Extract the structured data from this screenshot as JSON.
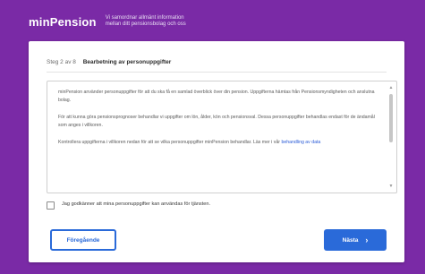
{
  "header": {
    "logo": "minPension",
    "tagline_line1": "Vi samordnar allmänt information",
    "tagline_line2": "mellan ditt pensionsbolag och oss"
  },
  "card": {
    "step": "Steg 2 av 8",
    "title": "Bearbetning av personuppgifter",
    "terms": {
      "p1": "minPension använder personuppgifter för att du ska få en samlad överblick över din pension. Uppgifterna hämtas från Pensionsmyndigheten och anslutna bolag.",
      "p2": "För att kunna göra pensionsprognoser behandlar vi uppgifter om lön, ålder, kön och pensionsval. Dessa personuppgifter behandlas endast för de ändamål som anges i villkoren.",
      "p3": "Kontrollera uppgifterna i villkoren nedan för att se vilka personuppgifter minPension behandlar. Läs mer i vår",
      "p3_link": "behandling av data"
    },
    "consent_label": "Jag godkänner att mina personuppgifter kan användas för tjänsten.",
    "back_button": "Föregående",
    "next_button": "Nästa",
    "next_icon": "›",
    "scroll_up_icon": "▲",
    "scroll_down_icon": "▼"
  }
}
